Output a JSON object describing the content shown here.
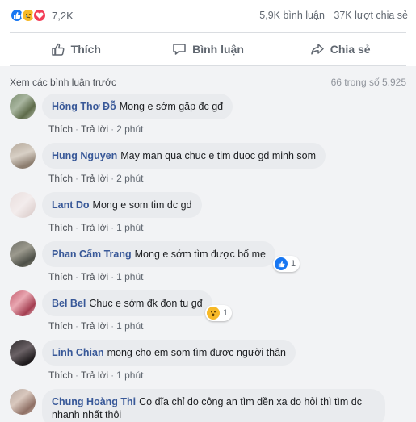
{
  "reactions": {
    "count": "7,2K"
  },
  "stats": {
    "comments": "5,9K bình luận",
    "shares": "37K lượt chia sẻ"
  },
  "actions": {
    "like": "Thích",
    "comment": "Bình luận",
    "share": "Chia sẻ"
  },
  "comments_section": {
    "view_previous": "Xem các bình luận trước",
    "count": "66 trong số 5.925"
  },
  "comments": [
    {
      "name": "Hồng Thơ Đỗ",
      "text": "Mong e sớm gặp đc gđ",
      "like": "Thích",
      "reply": "Trả lời",
      "time": "2 phút"
    },
    {
      "name": "Hung Nguyen",
      "text": "May man qua chuc e tim duoc gd minh som",
      "like": "Thích",
      "reply": "Trả lời",
      "time": "2 phút"
    },
    {
      "name": "Lant Do",
      "text": "Mong e som tim dc gd",
      "like": "Thích",
      "reply": "Trả lời",
      "time": "1 phút"
    },
    {
      "name": "Phan Cẩm Trang",
      "text": "Mong e sớm tìm được bố mẹ",
      "like": "Thích",
      "reply": "Trả lời",
      "time": "1 phút",
      "reaction_count": "1"
    },
    {
      "name": "Bel Bel",
      "text": "Chuc e sớm đk đon tu gđ",
      "like": "Thích",
      "reply": "Trả lời",
      "time": "1 phút",
      "reaction_count": "1"
    },
    {
      "name": "Linh Chian",
      "text": "mong cho em som tìm được người thân",
      "like": "Thích",
      "reply": "Trả lời",
      "time": "1 phút"
    },
    {
      "name": "Chung Hoàng Thi",
      "text": "Co dĩa chỉ do công an tìm dền xa do hỏi thì tìm dc nhanh nhất thôi"
    }
  ]
}
